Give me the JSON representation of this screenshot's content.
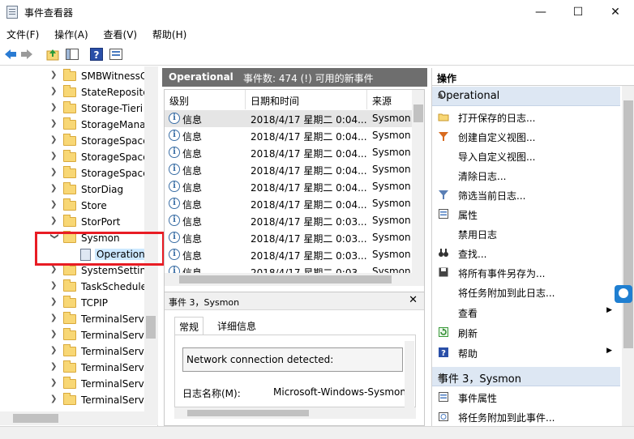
{
  "window": {
    "title": "事件查看器",
    "minimize": "—",
    "maximize": "☐",
    "close": "✕"
  },
  "menu": [
    "文件(F)",
    "操作(A)",
    "查看(V)",
    "帮助(H)"
  ],
  "toolbar_icons": [
    "back-icon",
    "forward-icon",
    "up-folder-icon",
    "show-hide-tree-icon",
    "help-icon",
    "properties-icon"
  ],
  "tree": {
    "items": [
      "SMBWitnessC",
      "StateReposito",
      "Storage-Tieri",
      "StorageMana",
      "StorageSpace",
      "StorageSpace",
      "StorageSpace",
      "StorDiag",
      "Store",
      "StorPort",
      "Sysmon"
    ],
    "child": "Operation",
    "items_after": [
      "SystemSetting",
      "TaskSchedule",
      "TCPIP",
      "TerminalServ",
      "TerminalServ",
      "TerminalServ",
      "TerminalServ",
      "TerminalServ",
      "TerminalServ"
    ]
  },
  "log": {
    "name": "Operational",
    "summary": "事件数: 474 (!) 可用的新事件",
    "columns": [
      "级别",
      "日期和时间",
      "来源"
    ],
    "rows": [
      {
        "level": "信息",
        "datetime": "2018/4/17 星期二 0:04...",
        "source": "Sysmon"
      },
      {
        "level": "信息",
        "datetime": "2018/4/17 星期二 0:04...",
        "source": "Sysmon"
      },
      {
        "level": "信息",
        "datetime": "2018/4/17 星期二 0:04...",
        "source": "Sysmon"
      },
      {
        "level": "信息",
        "datetime": "2018/4/17 星期二 0:04...",
        "source": "Sysmon"
      },
      {
        "level": "信息",
        "datetime": "2018/4/17 星期二 0:04...",
        "source": "Sysmon"
      },
      {
        "level": "信息",
        "datetime": "2018/4/17 星期二 0:04...",
        "source": "Sysmon"
      },
      {
        "level": "信息",
        "datetime": "2018/4/17 星期二 0:03...",
        "source": "Sysmon"
      },
      {
        "level": "信息",
        "datetime": "2018/4/17 星期二 0:03...",
        "source": "Sysmon"
      },
      {
        "level": "信息",
        "datetime": "2018/4/17 星期二 0:03...",
        "source": "Sysmon"
      },
      {
        "level": "信息",
        "datetime": "2018/4/17 星期二 0:03...",
        "source": "Sysmon"
      }
    ]
  },
  "detail": {
    "header": "事件 3，Sysmon",
    "close": "✕",
    "tabs": [
      "常规",
      "详细信息"
    ],
    "message": "Network connection detected:",
    "field_label": "日志名称(M):",
    "field_value": "Microsoft-Windows-Sysmon"
  },
  "actions": {
    "title": "操作",
    "section1": "Operational",
    "items1": [
      {
        "label": "打开保存的日志...",
        "icon": "open-folder-icon"
      },
      {
        "label": "创建自定义视图...",
        "icon": "filter-icon"
      },
      {
        "label": "导入自定义视图...",
        "icon": ""
      },
      {
        "label": "清除日志...",
        "icon": ""
      },
      {
        "label": "筛选当前日志...",
        "icon": "filter-icon"
      },
      {
        "label": "属性",
        "icon": "properties-icon"
      },
      {
        "label": "禁用日志",
        "icon": ""
      },
      {
        "label": "查找...",
        "icon": "binoculars-icon"
      },
      {
        "label": "将所有事件另存为...",
        "icon": "save-icon"
      },
      {
        "label": "将任务附加到此日志...",
        "icon": ""
      },
      {
        "label": "查看",
        "icon": "",
        "submenu": "▶"
      },
      {
        "label": "刷新",
        "icon": "refresh-icon"
      },
      {
        "label": "帮助",
        "icon": "help-icon",
        "submenu": "▶"
      }
    ],
    "section2": "事件 3，Sysmon",
    "items2": [
      {
        "label": "事件属性",
        "icon": "properties-icon"
      },
      {
        "label": "将任务附加到此事件...",
        "icon": "task-icon"
      }
    ]
  },
  "colors": {
    "accent": "#1f7fd1",
    "section_bg": "#dde7f3",
    "header_bg": "#6e6e6e",
    "highlight": "#e81c24"
  }
}
